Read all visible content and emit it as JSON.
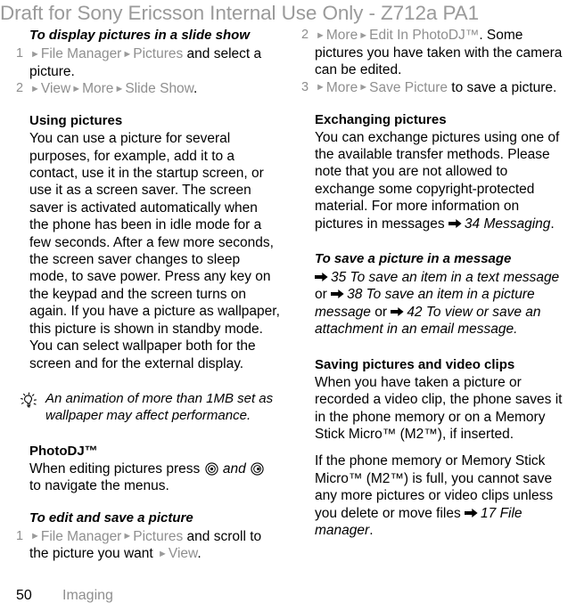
{
  "header": {
    "draft_notice": "Draft for Sony Ericsson Internal Use Only - Z712a PA1"
  },
  "footer": {
    "page_number": "50",
    "chapter": "Imaging"
  },
  "icons": {
    "tip": "lightbulb-icon",
    "navigation_key": "navigation-key-icon",
    "cross_reference": "right-arrow-icon",
    "menu_separator": "►"
  },
  "left_column": {
    "procedure_slideshow": {
      "heading": "To display pictures in a slide show",
      "steps": [
        {
          "number": "1",
          "parts": [
            {
              "type": "tri"
            },
            {
              "type": "ui",
              "text": "File Manager"
            },
            {
              "type": "tri"
            },
            {
              "type": "ui",
              "text": "Pictures"
            },
            {
              "type": "text",
              "text": " and select a picture."
            }
          ]
        },
        {
          "number": "2",
          "parts": [
            {
              "type": "tri"
            },
            {
              "type": "ui",
              "text": "View"
            },
            {
              "type": "tri"
            },
            {
              "type": "ui",
              "text": "More"
            },
            {
              "type": "tri"
            },
            {
              "type": "ui",
              "text": "Slide Show"
            },
            {
              "type": "text",
              "text": "."
            }
          ]
        }
      ]
    },
    "section_using_pictures": {
      "heading": "Using pictures",
      "body": "You can use a picture for several purposes, for example, add it to a contact, use it in the startup screen, or use it as a screen saver. The screen saver is activated automatically when the phone has been in idle mode for a few seconds. After a few more seconds, the screen saver changes to sleep mode, to save power. Press any key on the keypad and the screen turns on again. If you have a picture as wallpaper, this picture is shown in standby mode. You can select wallpaper both for the screen and for the external display."
    },
    "tip_note": {
      "text": "An animation of more than 1MB set as wallpaper may affect performance."
    },
    "section_photodj": {
      "heading": "PhotoDJ™",
      "body_before_key1": "When editing pictures press ",
      "body_between_keys": " and ",
      "body_after_key2": " to navigate the menus."
    },
    "procedure_edit_save": {
      "heading": "To edit and save a picture",
      "steps": [
        {
          "number": "1",
          "parts": [
            {
              "type": "tri"
            },
            {
              "type": "ui",
              "text": "File Manager"
            },
            {
              "type": "tri"
            },
            {
              "type": "ui",
              "text": "Pictures"
            },
            {
              "type": "text",
              "text": " and scroll to the picture you want "
            },
            {
              "type": "tri"
            },
            {
              "type": "ui",
              "text": "View"
            },
            {
              "type": "text",
              "text": "."
            }
          ]
        }
      ]
    }
  },
  "right_column": {
    "procedure_continued_steps": [
      {
        "number": "2",
        "parts": [
          {
            "type": "tri"
          },
          {
            "type": "ui",
            "text": "More"
          },
          {
            "type": "tri"
          },
          {
            "type": "ui",
            "text": "Edit In PhotoDJ™"
          },
          {
            "type": "text",
            "text": ". Some pictures you have taken with the camera can be edited."
          }
        ]
      },
      {
        "number": "3",
        "parts": [
          {
            "type": "tri"
          },
          {
            "type": "ui",
            "text": "More"
          },
          {
            "type": "tri"
          },
          {
            "type": "ui",
            "text": "Save Picture"
          },
          {
            "type": "text",
            "text": " to save a picture."
          }
        ]
      }
    ],
    "section_exchanging": {
      "heading": "Exchanging pictures",
      "body": "You can exchange pictures using one of the available transfer methods. Please note that you are not allowed to exchange some copyright-protected material. For more information on pictures in messages ",
      "xref": "34 Messaging",
      "body_end": "."
    },
    "procedure_save_in_message": {
      "heading": "To save a picture in a message",
      "xref1": "35 To save an item in a text message",
      "conn1": " or ",
      "xref2": "38 To save an item in a picture message",
      "conn2": " or ",
      "xref3": "42 To view or save an attachment in an email message",
      "end": "."
    },
    "section_saving": {
      "heading": "Saving pictures and video clips",
      "body1": "When you have taken a picture or recorded a video clip, the phone saves it in the phone memory or on a Memory Stick Micro™ (M2™), if inserted.",
      "body2_before": "If the phone memory or Memory Stick Micro™ (M2™) is full, you cannot save any more pictures or video clips unless you delete or move files ",
      "body2_xref": "17 File manager",
      "body2_end": "."
    }
  }
}
